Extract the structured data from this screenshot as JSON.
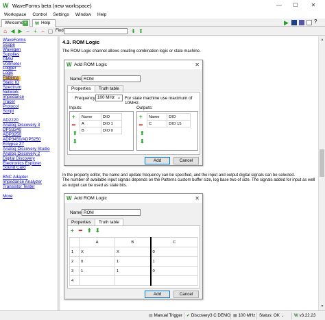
{
  "app": {
    "title": "WaveForms beta (new workspace)"
  },
  "menu": [
    "Workspace",
    "Control",
    "Settings",
    "Window",
    "Help"
  ],
  "tabs": {
    "welcome": "Welcome",
    "help": "Help"
  },
  "find": {
    "label": "Find:",
    "value": ""
  },
  "sidebar": {
    "group1": [
      "WaveForms",
      "Scope",
      "Wavegen",
      "Supplies",
      "DMM",
      "Voltmeter",
      "Logger",
      "Logic",
      "Patterns",
      "Static IO",
      "Spectrum",
      "Network",
      "Impedance",
      "Tracer",
      "Protocol",
      "Script"
    ],
    "group2": [
      "AD2220",
      "Analog Discovery 3",
      "DPS3340",
      "ADP3250",
      "ADP3450/ADP5250",
      "Eclypse Z7",
      "Analog Discovery Studio",
      "Analog Discovery 2",
      "Digital Discovery",
      "Electronics Explorer",
      "Sound Card"
    ],
    "group3": [
      "BNC Adapter",
      "Impedance Analyzer",
      "Transistor Tester"
    ],
    "group4": [
      "More"
    ],
    "selected": "Patterns"
  },
  "content": {
    "heading": "4.3. ROM Logic",
    "intro": "The ROM Logic channel allows creating combination logic or state machine.",
    "para1": "In the property editor, the name and update frequency can be specified, and the input and output digital signals can be selected.",
    "para2": "The number of available input signals depends on the Patterns custom buffer size, log base two of size. The signals added for input as well as output can be used as state bits."
  },
  "dialog1": {
    "title": "Add ROM Logic",
    "name_label": "Name:",
    "name_value": "ROM",
    "tab_properties": "Properties",
    "tab_truth": "Truth table",
    "freq_label": "Frequency:",
    "freq_value": "100 MHz",
    "freq_note": "For state machine use maximum of 10MHz.",
    "inputs_label": "Inputs:",
    "outputs_label": "Outputs:",
    "col_name": "Name",
    "col_dio": "DIO",
    "inputs": [
      {
        "name": "A",
        "dio": "DIO 1"
      },
      {
        "name": "B",
        "dio": "DIO 0"
      }
    ],
    "outputs": [
      {
        "name": "C",
        "dio": "DIO 15"
      }
    ],
    "add": "Add",
    "cancel": "Cancel"
  },
  "dialog2": {
    "title": "Add ROM Logic",
    "name_label": "Name:",
    "name_value": "ROM",
    "tab_properties": "Properties",
    "tab_truth": "Truth table",
    "headers": [
      "A",
      "B",
      "C"
    ],
    "rows": [
      [
        "1",
        "X",
        "X",
        "0"
      ],
      [
        "2",
        "0",
        "1",
        "1"
      ],
      [
        "3",
        "1",
        "1",
        "0"
      ],
      [
        "4",
        "",
        "",
        ""
      ]
    ],
    "add": "Add",
    "cancel": "Cancel"
  },
  "status": {
    "trigger": "Manual Trigger",
    "device": "Discovery3 C DEMO",
    "freq": "100 MHz",
    "status": "Status: OK",
    "version": "v3.22.23"
  },
  "colors": {
    "link": "#0000cc",
    "selected": "#ffcc44",
    "accent": "#2ea02e"
  }
}
